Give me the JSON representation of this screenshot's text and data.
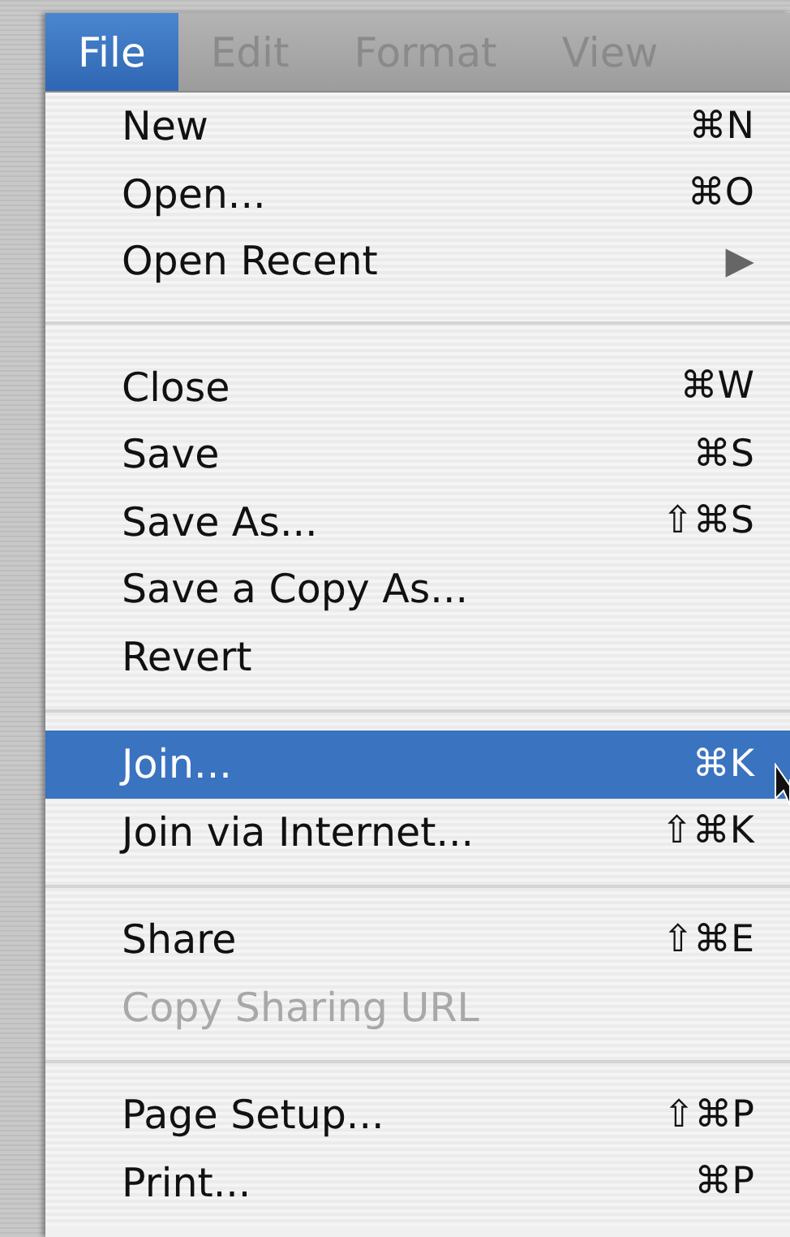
{
  "menubar": [
    {
      "label": "File",
      "selected": true
    },
    {
      "label": "Edit",
      "selected": false
    },
    {
      "label": "Format",
      "selected": false
    },
    {
      "label": "View",
      "selected": false
    }
  ],
  "menu": {
    "items": [
      {
        "kind": "item",
        "label": "New",
        "shortcut": "⌘N",
        "selected": false,
        "disabled": false
      },
      {
        "kind": "item",
        "label": "Open...",
        "shortcut": "⌘O",
        "selected": false,
        "disabled": false
      },
      {
        "kind": "submenu",
        "label": "Open Recent",
        "arrow": "▶",
        "selected": false,
        "disabled": false
      },
      {
        "kind": "separator"
      },
      {
        "kind": "item",
        "label": "Close",
        "shortcut": "⌘W",
        "selected": false,
        "disabled": false
      },
      {
        "kind": "item",
        "label": "Save",
        "shortcut": "⌘S",
        "selected": false,
        "disabled": false
      },
      {
        "kind": "item",
        "label": "Save As...",
        "shortcut": "⇧⌘S",
        "selected": false,
        "disabled": false
      },
      {
        "kind": "item",
        "label": "Save a Copy As...",
        "selected": false,
        "disabled": false
      },
      {
        "kind": "item",
        "label": "Revert",
        "selected": false,
        "disabled": false
      },
      {
        "kind": "separator"
      },
      {
        "kind": "item",
        "label": "Join...",
        "shortcut": "⌘K",
        "selected": true,
        "disabled": false
      },
      {
        "kind": "item",
        "label": "Join via Internet...",
        "shortcut": "⇧⌘K",
        "selected": false,
        "disabled": false
      },
      {
        "kind": "separator"
      },
      {
        "kind": "item",
        "label": "Share",
        "shortcut": "⇧⌘E",
        "selected": false,
        "disabled": false
      },
      {
        "kind": "item",
        "label": "Copy Sharing URL",
        "selected": false,
        "disabled": true
      },
      {
        "kind": "separator"
      },
      {
        "kind": "item",
        "label": "Page Setup...",
        "shortcut": "⇧⌘P",
        "selected": false,
        "disabled": false
      },
      {
        "kind": "item",
        "label": "Print...",
        "shortcut": "⌘P",
        "selected": false,
        "disabled": false
      }
    ]
  }
}
